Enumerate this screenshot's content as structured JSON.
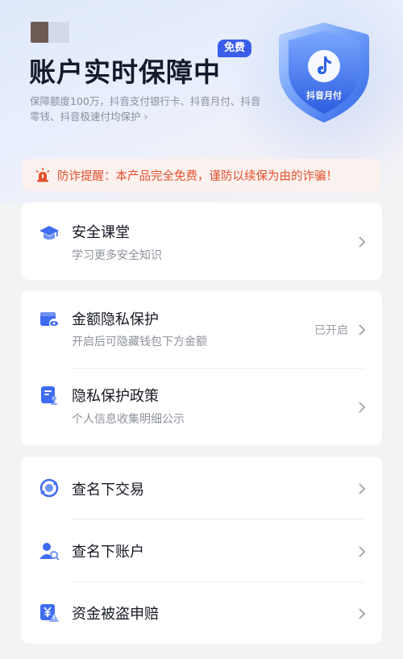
{
  "header": {
    "title": "账户实时保障中",
    "badge": "免费",
    "subtitle": "保障额度100万，抖音支付银行卡、抖音月付、抖音零钱、抖音极速付均保护",
    "subtitle_arrow": "›",
    "shield_label": "抖音月付"
  },
  "notice": {
    "text": "防诈提醒：本产品完全免费，谨防以续保为由的诈骗！",
    "color": "#e3502d"
  },
  "card1": {
    "items": [
      {
        "label": "安全课堂",
        "desc": "学习更多安全知识"
      }
    ]
  },
  "card2": {
    "items": [
      {
        "label": "金额隐私保护",
        "desc": "开启后可隐藏钱包下方金额",
        "status": "已开启"
      },
      {
        "label": "隐私保护政策",
        "desc": "个人信息收集明细公示"
      }
    ]
  },
  "card3": {
    "items": [
      {
        "label": "查名下交易"
      },
      {
        "label": "查名下账户"
      },
      {
        "label": "资金被盗申赔"
      }
    ]
  },
  "colors": {
    "accent": "#3a5dea",
    "icon_blue": "#3f6cf0",
    "warning": "#e3502d"
  },
  "icons": [
    "shield-icon",
    "douyin-logo-icon",
    "alarm-icon",
    "graduation-cap-icon",
    "wallet-eye-icon",
    "document-person-icon",
    "search-transaction-icon",
    "person-search-icon",
    "yuan-warning-icon",
    "chevron-right-icon"
  ]
}
